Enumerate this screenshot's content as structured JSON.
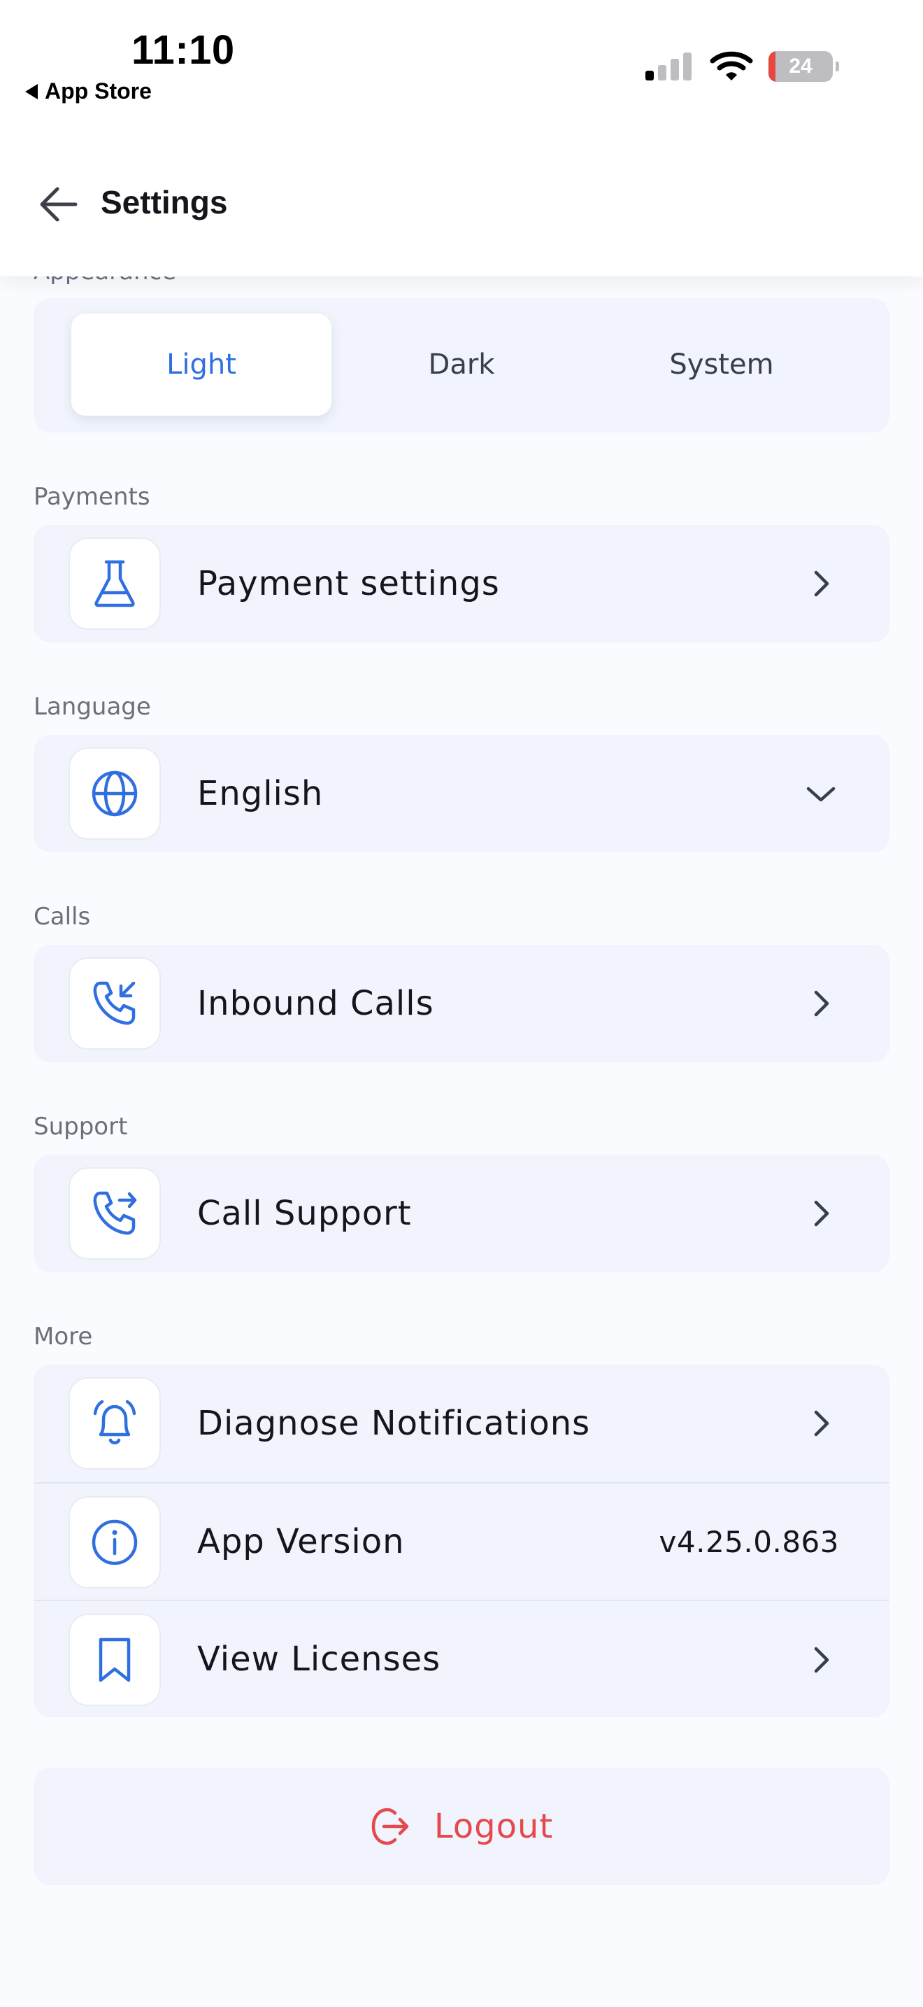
{
  "status_bar": {
    "time": "11:10",
    "back_app": "App Store",
    "battery": "24"
  },
  "header": {
    "title": "Settings"
  },
  "appearance": {
    "label": "Appearance",
    "options": [
      "Light",
      "Dark",
      "System"
    ],
    "selected": "Light"
  },
  "payments": {
    "label": "Payments",
    "item": "Payment settings"
  },
  "language": {
    "label": "Language",
    "value": "English"
  },
  "calls": {
    "label": "Calls",
    "item": "Inbound Calls"
  },
  "support": {
    "label": "Support",
    "item": "Call Support"
  },
  "more": {
    "label": "More",
    "items": [
      {
        "label": "Diagnose Notifications"
      },
      {
        "label": "App Version",
        "value": "v4.25.0.863"
      },
      {
        "label": "View Licenses"
      }
    ]
  },
  "logout": {
    "label": "Logout"
  },
  "colors": {
    "accent": "#2F6FE0",
    "danger": "#E5484D",
    "card": "#F1F4FC"
  }
}
